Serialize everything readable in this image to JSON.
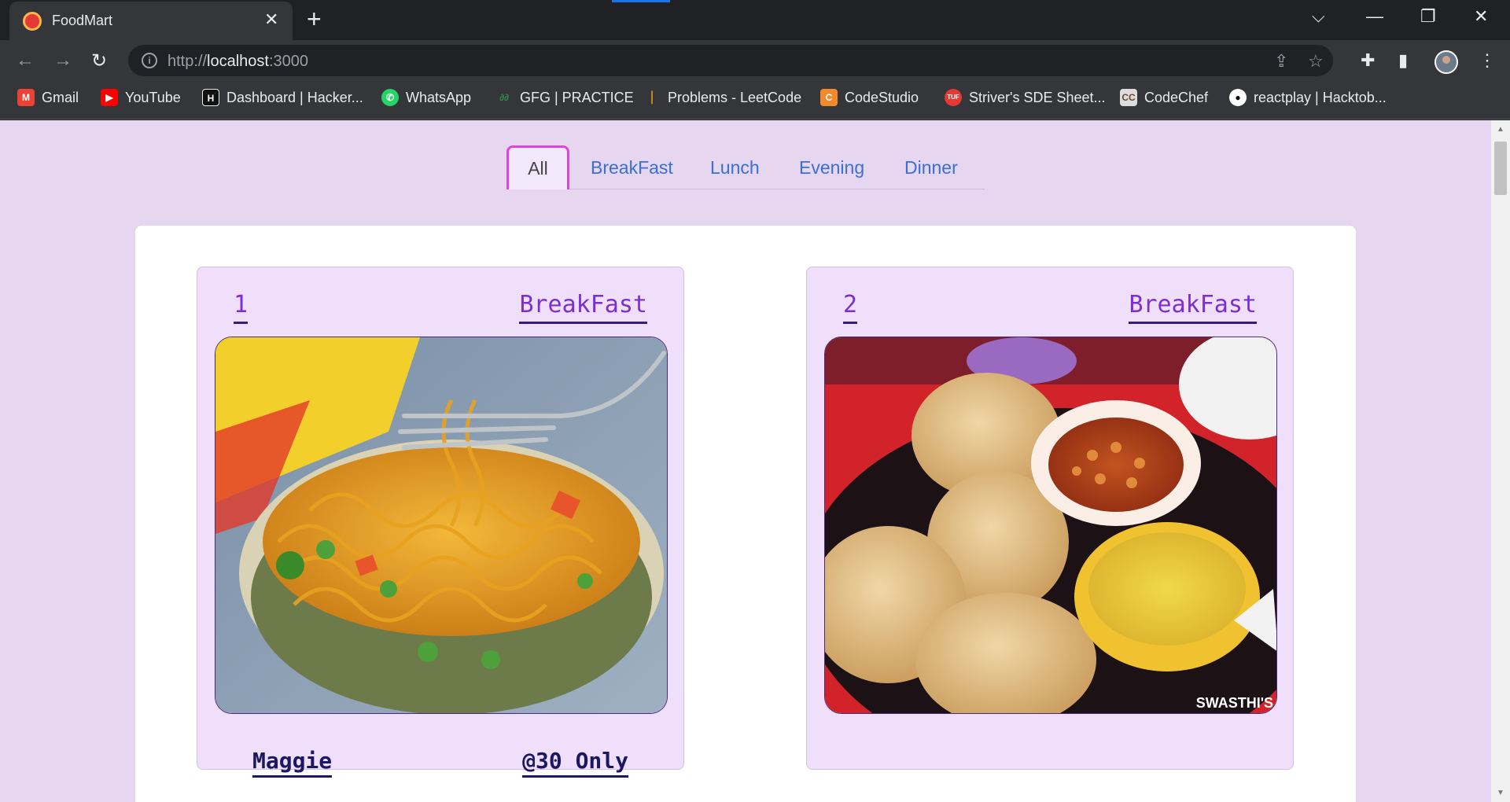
{
  "browser": {
    "tab_title": "FoodMart",
    "url_scheme": "http://",
    "url_host": "localhost",
    "url_port": ":3000",
    "bookmarks": [
      {
        "label": "Gmail",
        "icon": "gmail-icon",
        "color": "#ea4335"
      },
      {
        "label": "YouTube",
        "icon": "youtube-icon",
        "color": "#ff0000"
      },
      {
        "label": "Dashboard | Hacker...",
        "icon": "hackerrank-icon",
        "color": "#111111"
      },
      {
        "label": "WhatsApp",
        "icon": "whatsapp-icon",
        "color": "#25d366"
      },
      {
        "label": "GFG | PRACTICE",
        "icon": "gfg-icon",
        "color": "#2f8d46"
      },
      {
        "label": "Problems - LeetCode",
        "icon": "leetcode-icon",
        "color": "#ffa116"
      },
      {
        "label": "CodeStudio",
        "icon": "codestudio-icon",
        "color": "#f18a2a"
      },
      {
        "label": "Striver's SDE Sheet...",
        "icon": "tuf-icon",
        "color": "#e53935"
      },
      {
        "label": "CodeChef",
        "icon": "codechef-icon",
        "color": "#6b4a2b"
      },
      {
        "label": "reactplay | Hacktob...",
        "icon": "github-icon",
        "color": "#ffffff"
      }
    ]
  },
  "menu": {
    "items": [
      "All",
      "BreakFast",
      "Lunch",
      "Evening",
      "Dinner"
    ],
    "active": "All"
  },
  "cards": [
    {
      "id": "1",
      "category": "BreakFast",
      "name": "Maggie",
      "price": "@30 Only",
      "image": "maggie-noodles-image"
    },
    {
      "id": "2",
      "category": "BreakFast",
      "image": "poori-chole-image",
      "watermark": "SWASTHI'S"
    }
  ],
  "colors": {
    "page_bg": "#e6d6f0",
    "card_bg": "#f0dffb",
    "accent_purple": "#7b2fd0",
    "menu_link": "#3b6fd4",
    "active_border": "#e044e0"
  }
}
